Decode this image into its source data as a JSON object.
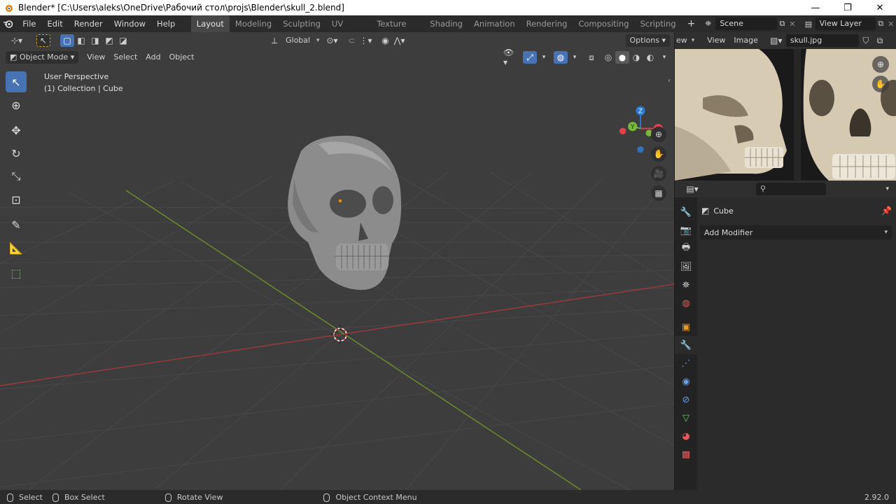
{
  "window": {
    "title": "Blender* [C:\\Users\\aleks\\OneDrive\\Рабочий стол\\projs\\Blender\\skull_2.blend]",
    "minimize": "—",
    "restore": "❐",
    "close": "✕"
  },
  "menubar": {
    "items": [
      "File",
      "Edit",
      "Render",
      "Window",
      "Help"
    ],
    "workspaces": [
      "Layout",
      "Modeling",
      "Sculpting",
      "UV Editing",
      "Texture Paint",
      "Shading",
      "Animation",
      "Rendering",
      "Compositing",
      "Scripting"
    ],
    "active_workspace": "Layout",
    "add_workspace": "+",
    "scene": "Scene",
    "view_layer": "View Layer"
  },
  "viewport": {
    "header": {
      "transform_orientation": "Global",
      "options_label": "Options"
    },
    "header2": {
      "mode": "Object Mode",
      "menus": [
        "View",
        "Select",
        "Add",
        "Object"
      ]
    },
    "info_line1": "User Perspective",
    "info_line2": "(1) Collection | Cube",
    "gizmo": {
      "z": "Z",
      "y": "Y",
      "x": "X"
    }
  },
  "image_editor": {
    "menus": [
      "ew",
      "View",
      "Image"
    ],
    "image_name": "skull.jpg"
  },
  "properties": {
    "object_name": "Cube",
    "add_modifier": "Add Modifier"
  },
  "statusbar": {
    "select": "Select",
    "box_select": "Box Select",
    "rotate_view": "Rotate View",
    "context_menu": "Object Context Menu",
    "version": "2.92.0"
  },
  "colors": {
    "accent": "#4772b3",
    "x_axis": "#e8404a",
    "y_axis": "#78b83a",
    "z_axis": "#2d7bd1",
    "grid_bg": "#3d3d3d"
  }
}
